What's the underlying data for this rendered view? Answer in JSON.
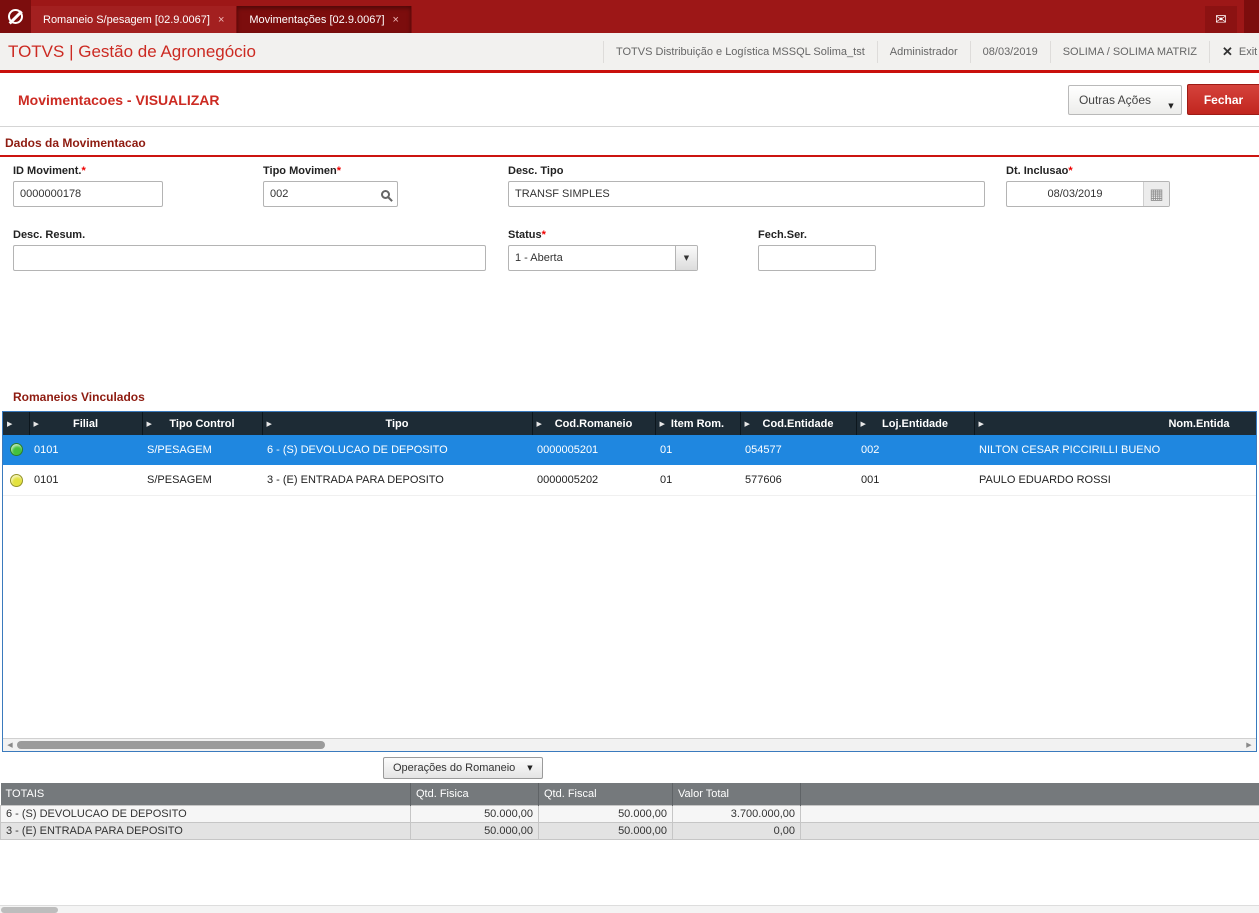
{
  "colors": {
    "topbar": "#9d1717",
    "active_tab": "#7c0d0d",
    "accent_red": "#cc2a22",
    "grid_header_bg": "#1d2b35",
    "selected_row_bg": "#1f87e0",
    "totals_header_bg": "#75797c",
    "status_green": "#44c13c",
    "status_yellow": "#e3e23e"
  },
  "icons": {
    "header_arrow": "▶",
    "caret_down": "▼",
    "mail": "✉",
    "close_x": "✕",
    "tab_close": "×",
    "calendar": "▦",
    "scroll_left": "◀",
    "scroll_right": "▶"
  },
  "titlebar": {
    "tabs": [
      {
        "label": "Romaneio S/pesagem [02.9.0067]",
        "active": false
      },
      {
        "label": "Movimentações [02.9.0067]",
        "active": true
      }
    ]
  },
  "header": {
    "app_title": "TOTVS | Gestão de Agronegócio",
    "environment": "TOTVS Distribuição e Logística MSSQL Solima_tst",
    "user": "Administrador",
    "date": "08/03/2019",
    "company": "SOLIMA / SOLIMA MATRIZ",
    "exit_label": "Exit"
  },
  "toolbar": {
    "page_title": "Movimentacoes - VISUALIZAR",
    "outras_acoes_label": "Outras Ações",
    "fechar_label": "Fechar"
  },
  "form": {
    "section_title": "Dados da Movimentacao",
    "required_marker": "*",
    "id_moviment": {
      "label": "ID Moviment.",
      "value": "0000000178"
    },
    "tipo_movimen": {
      "label": "Tipo Movimen",
      "value": "002"
    },
    "desc_tipo": {
      "label": "Desc. Tipo",
      "value": "TRANSF SIMPLES"
    },
    "dt_inclusao": {
      "label": "Dt. Inclusao",
      "value": "08/03/2019"
    },
    "desc_resum": {
      "label": "Desc. Resum.",
      "value": ""
    },
    "status": {
      "label": "Status",
      "value": "1 - Aberta"
    },
    "fech_ser": {
      "label": "Fech.Ser.",
      "value": ""
    }
  },
  "grid": {
    "section_title": "Romaneios Vinculados",
    "columns": [
      "Filial",
      "Tipo Control",
      "Tipo",
      "Cod.Romaneio",
      "Item Rom.",
      "Cod.Entidade",
      "Loj.Entidade",
      "Nom.Entida"
    ],
    "rows": [
      {
        "selected": true,
        "status_color": "#44c13c",
        "cells": [
          "0101",
          "S/PESAGEM",
          "6 - (S) DEVOLUCAO DE DEPOSITO",
          "0000005201",
          "01",
          "054577",
          "002",
          "NILTON CESAR PICCIRILLI BUENO"
        ]
      },
      {
        "selected": false,
        "status_color": "#e3e23e",
        "cells": [
          "0101",
          "S/PESAGEM",
          "3 - (E) ENTRADA PARA DEPOSITO",
          "0000005202",
          "01",
          "577606",
          "001",
          "PAULO EDUARDO ROSSI"
        ]
      }
    ],
    "operacoes_label": "Operações do Romaneio"
  },
  "totals": {
    "columns": [
      "TOTAIS",
      "Qtd. Fisica",
      "Qtd. Fiscal",
      "Valor Total"
    ],
    "rows": [
      [
        "6 - (S) DEVOLUCAO DE DEPOSITO",
        "50.000,00",
        "50.000,00",
        "3.700.000,00"
      ],
      [
        "3 - (E) ENTRADA PARA DEPOSITO",
        "50.000,00",
        "50.000,00",
        "0,00"
      ]
    ]
  }
}
